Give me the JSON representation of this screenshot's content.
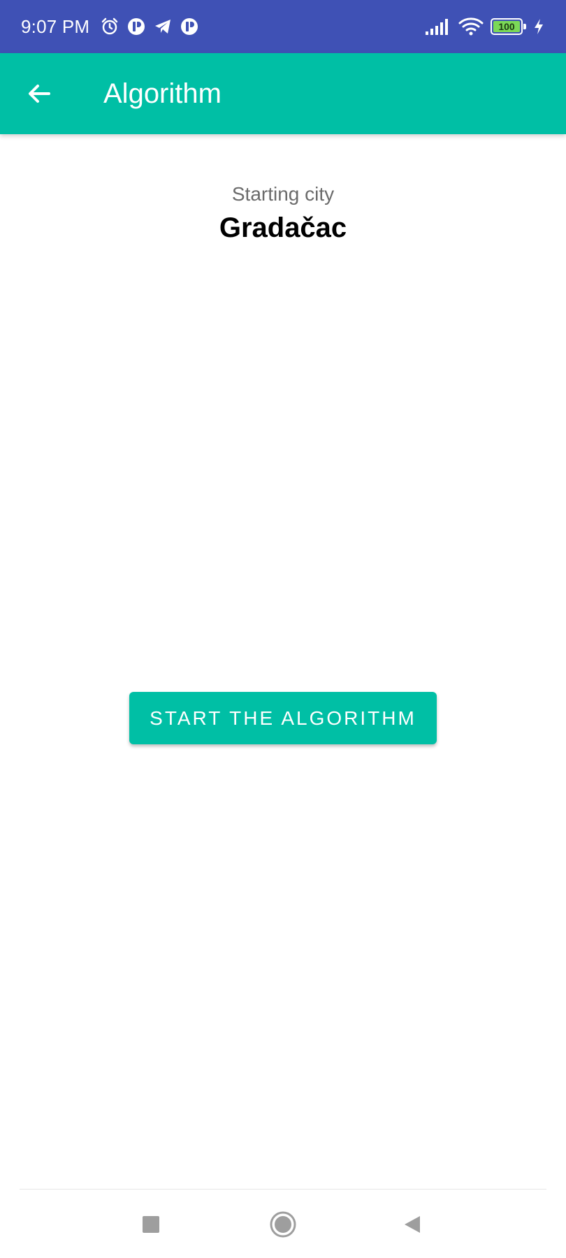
{
  "status_bar": {
    "time": "9:07 PM",
    "icons_left": [
      "alarm-icon",
      "app-notification-icon",
      "telegram-icon",
      "app-notification-icon"
    ],
    "icons_right": [
      "cellular-signal-icon",
      "wifi-icon",
      "battery-icon",
      "charging-icon"
    ],
    "battery_level": "100",
    "background_color": "#3f51b5"
  },
  "app_bar": {
    "title": "Algorithm",
    "back_icon": "arrow-back-icon",
    "background_color": "#00bfa5"
  },
  "main": {
    "starting_city_label": "Starting city",
    "starting_city_value": "Gradačac",
    "start_button_label": "START THE ALGORITHM",
    "accent_color": "#00bfa5"
  },
  "nav_bar": {
    "buttons": [
      "recents-icon",
      "home-icon",
      "back-icon"
    ]
  }
}
